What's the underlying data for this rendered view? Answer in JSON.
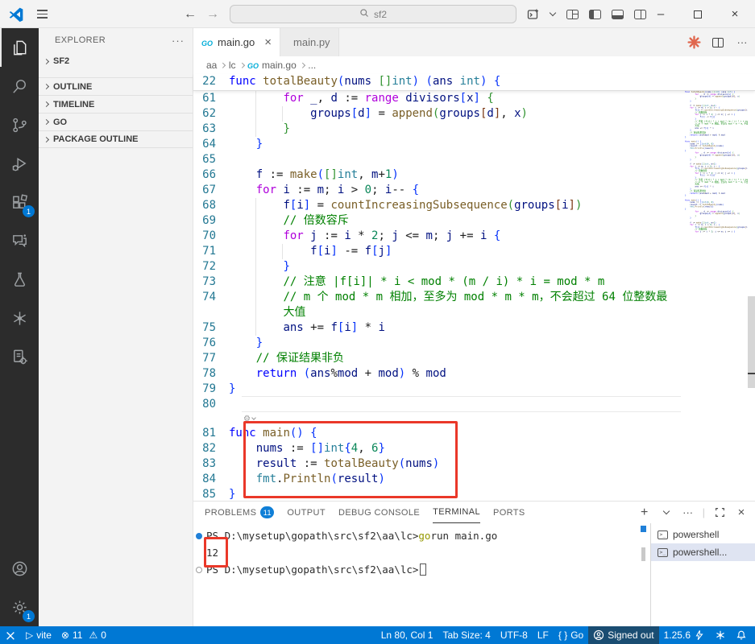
{
  "colors": {
    "accent": "#0078d4",
    "annotation_red": "#ea3829",
    "status_bg": "#0078d4",
    "status_secondary_bg": "#1a4d72",
    "activity_bar_bg": "#2c2c2c",
    "terminal_command_highlight": "#949800",
    "go_brand": "#00add8"
  },
  "title_bar": {
    "search_value": "sf2"
  },
  "activity_bar": {
    "items": [
      {
        "name": "explorer",
        "active": true
      },
      {
        "name": "search"
      },
      {
        "name": "source-control"
      },
      {
        "name": "run-debug"
      },
      {
        "name": "extensions",
        "badge": "1"
      },
      {
        "name": "chat"
      },
      {
        "name": "testing"
      },
      {
        "name": "go-extension"
      },
      {
        "name": "tasks"
      }
    ],
    "bottom": [
      {
        "name": "account"
      },
      {
        "name": "settings",
        "badge": "1"
      }
    ]
  },
  "sidebar": {
    "title": "EXPLORER",
    "sections": [
      {
        "label": "SF2",
        "expanded": true
      },
      {
        "label": "OUTLINE"
      },
      {
        "label": "TIMELINE"
      },
      {
        "label": "GO"
      },
      {
        "label": "PACKAGE OUTLINE"
      }
    ]
  },
  "editor": {
    "tabs": [
      {
        "label": "main.go",
        "icon": "go",
        "active": true,
        "close": "×"
      },
      {
        "label": "main.py",
        "icon": "python",
        "active": false
      }
    ],
    "breadcrumb": [
      {
        "label": "aa"
      },
      {
        "label": "lc"
      },
      {
        "label": "main.go",
        "icon": "go"
      },
      {
        "label": "..."
      }
    ],
    "sticky": {
      "n": "22",
      "ind": 0,
      "tokens": [
        [
          "kw",
          "func "
        ],
        [
          "fn",
          "totalBeauty"
        ],
        [
          "b1",
          "("
        ],
        [
          "v",
          "nums"
        ],
        [
          "pl",
          " "
        ],
        [
          "b2",
          "[]"
        ],
        [
          "ty",
          "int"
        ],
        [
          "b1",
          ")"
        ],
        [
          "pl",
          " "
        ],
        [
          "b1",
          "("
        ],
        [
          "v",
          "ans"
        ],
        [
          "pl",
          " "
        ],
        [
          "ty",
          "int"
        ],
        [
          "b1",
          ")"
        ],
        [
          "pl",
          " "
        ],
        [
          "b1",
          "{"
        ]
      ]
    },
    "lines": [
      {
        "n": "61",
        "ind": 2,
        "tokens": [
          [
            "ctrl",
            "for "
          ],
          [
            "v",
            "_"
          ],
          [
            "pl",
            ", "
          ],
          [
            "v",
            "d"
          ],
          [
            "op",
            " := "
          ],
          [
            "ctrl",
            "range "
          ],
          [
            "v",
            "divisors"
          ],
          [
            "b1",
            "["
          ],
          [
            "v",
            "x"
          ],
          [
            "b1",
            "]"
          ],
          [
            "pl",
            " "
          ],
          [
            "b2",
            "{"
          ]
        ]
      },
      {
        "n": "62",
        "ind": 3,
        "tokens": [
          [
            "v",
            "groups"
          ],
          [
            "b1",
            "["
          ],
          [
            "v",
            "d"
          ],
          [
            "b1",
            "]"
          ],
          [
            "op",
            " = "
          ],
          [
            "fn",
            "append"
          ],
          [
            "b2",
            "("
          ],
          [
            "v",
            "groups"
          ],
          [
            "b3",
            "["
          ],
          [
            "v",
            "d"
          ],
          [
            "b3",
            "]"
          ],
          [
            "pl",
            ", "
          ],
          [
            "v",
            "x"
          ],
          [
            "b2",
            ")"
          ]
        ]
      },
      {
        "n": "63",
        "ind": 2,
        "tokens": [
          [
            "b2",
            "}"
          ]
        ]
      },
      {
        "n": "64",
        "ind": 1,
        "tokens": [
          [
            "b1",
            "}"
          ]
        ]
      },
      {
        "n": "65",
        "ind": 0,
        "tokens": []
      },
      {
        "n": "66",
        "ind": 1,
        "tokens": [
          [
            "v",
            "f"
          ],
          [
            "op",
            " := "
          ],
          [
            "fn",
            "make"
          ],
          [
            "b1",
            "("
          ],
          [
            "b2",
            "[]"
          ],
          [
            "ty",
            "int"
          ],
          [
            "pl",
            ", "
          ],
          [
            "v",
            "m"
          ],
          [
            "op",
            "+"
          ],
          [
            "num",
            "1"
          ],
          [
            "b1",
            ")"
          ]
        ]
      },
      {
        "n": "67",
        "ind": 1,
        "tokens": [
          [
            "ctrl",
            "for "
          ],
          [
            "v",
            "i"
          ],
          [
            "op",
            " := "
          ],
          [
            "v",
            "m"
          ],
          [
            "pl",
            "; "
          ],
          [
            "v",
            "i"
          ],
          [
            "op",
            " > "
          ],
          [
            "num",
            "0"
          ],
          [
            "pl",
            "; "
          ],
          [
            "v",
            "i"
          ],
          [
            "op",
            "--"
          ],
          [
            "pl",
            " "
          ],
          [
            "b1",
            "{"
          ]
        ]
      },
      {
        "n": "68",
        "ind": 2,
        "tokens": [
          [
            "v",
            "f"
          ],
          [
            "b1",
            "["
          ],
          [
            "v",
            "i"
          ],
          [
            "b1",
            "]"
          ],
          [
            "op",
            " = "
          ],
          [
            "fn",
            "countIncreasingSubsequence"
          ],
          [
            "b2",
            "("
          ],
          [
            "v",
            "groups"
          ],
          [
            "b3",
            "["
          ],
          [
            "v",
            "i"
          ],
          [
            "b3",
            "]"
          ],
          [
            "b2",
            ")"
          ]
        ]
      },
      {
        "n": "69",
        "ind": 2,
        "tokens": [
          [
            "cm",
            "// 倍数容斥"
          ]
        ]
      },
      {
        "n": "70",
        "ind": 2,
        "tokens": [
          [
            "ctrl",
            "for "
          ],
          [
            "v",
            "j"
          ],
          [
            "op",
            " := "
          ],
          [
            "v",
            "i"
          ],
          [
            "op",
            " * "
          ],
          [
            "num",
            "2"
          ],
          [
            "pl",
            "; "
          ],
          [
            "v",
            "j"
          ],
          [
            "op",
            " <= "
          ],
          [
            "v",
            "m"
          ],
          [
            "pl",
            "; "
          ],
          [
            "v",
            "j"
          ],
          [
            "op",
            " += "
          ],
          [
            "v",
            "i"
          ],
          [
            "pl",
            " "
          ],
          [
            "b1",
            "{"
          ]
        ]
      },
      {
        "n": "71",
        "ind": 3,
        "tokens": [
          [
            "v",
            "f"
          ],
          [
            "b1",
            "["
          ],
          [
            "v",
            "i"
          ],
          [
            "b1",
            "]"
          ],
          [
            "op",
            " -= "
          ],
          [
            "v",
            "f"
          ],
          [
            "b1",
            "["
          ],
          [
            "v",
            "j"
          ],
          [
            "b1",
            "]"
          ]
        ]
      },
      {
        "n": "72",
        "ind": 2,
        "tokens": [
          [
            "b1",
            "}"
          ]
        ]
      },
      {
        "n": "73",
        "ind": 2,
        "tokens": [
          [
            "cm",
            "// 注意 |f[i]| * i < mod * (m / i) * i = mod * m"
          ]
        ]
      },
      {
        "n": "74",
        "ind": 2,
        "tokens": [
          [
            "cm",
            "// m 个 mod * m 相加，至多为 mod * m * m，不会超过 64 位整数最"
          ]
        ]
      },
      {
        "n": "",
        "ind": 2,
        "tokens": [
          [
            "cm",
            "大值"
          ]
        ]
      },
      {
        "n": "75",
        "ind": 2,
        "tokens": [
          [
            "v",
            "ans"
          ],
          [
            "op",
            " += "
          ],
          [
            "v",
            "f"
          ],
          [
            "b1",
            "["
          ],
          [
            "v",
            "i"
          ],
          [
            "b1",
            "]"
          ],
          [
            "op",
            " * "
          ],
          [
            "v",
            "i"
          ]
        ]
      },
      {
        "n": "76",
        "ind": 1,
        "tokens": [
          [
            "b1",
            "}"
          ]
        ]
      },
      {
        "n": "77",
        "ind": 1,
        "tokens": [
          [
            "cm",
            "// 保证结果非负"
          ]
        ]
      },
      {
        "n": "78",
        "ind": 1,
        "tokens": [
          [
            "kw",
            "return "
          ],
          [
            "b1",
            "("
          ],
          [
            "v",
            "ans"
          ],
          [
            "op",
            "%"
          ],
          [
            "v",
            "mod"
          ],
          [
            "op",
            " + "
          ],
          [
            "v",
            "mod"
          ],
          [
            "b1",
            ")"
          ],
          [
            "op",
            " % "
          ],
          [
            "v",
            "mod"
          ]
        ]
      },
      {
        "n": "79",
        "ind": 0,
        "tokens": [
          [
            "b1",
            "}"
          ]
        ],
        "sep": true
      },
      {
        "n": "80",
        "ind": 0,
        "tokens": [],
        "sep": true
      },
      {
        "widget": "code-action"
      },
      {
        "n": "81",
        "ind": 0,
        "tokens": [
          [
            "kw",
            "func "
          ],
          [
            "fn",
            "main"
          ],
          [
            "b1",
            "()"
          ],
          [
            "pl",
            " "
          ],
          [
            "b1",
            "{"
          ]
        ]
      },
      {
        "n": "82",
        "ind": 1,
        "tokens": [
          [
            "v",
            "nums"
          ],
          [
            "op",
            " := "
          ],
          [
            "b1",
            "[]"
          ],
          [
            "ty",
            "int"
          ],
          [
            "b1",
            "{"
          ],
          [
            "num",
            "4"
          ],
          [
            "pl",
            ", "
          ],
          [
            "num",
            "6"
          ],
          [
            "b1",
            "}"
          ]
        ]
      },
      {
        "n": "83",
        "ind": 1,
        "tokens": [
          [
            "v",
            "result"
          ],
          [
            "op",
            " := "
          ],
          [
            "fn",
            "totalBeauty"
          ],
          [
            "b1",
            "("
          ],
          [
            "v",
            "nums"
          ],
          [
            "b1",
            ")"
          ]
        ]
      },
      {
        "n": "84",
        "ind": 1,
        "tokens": [
          [
            "ty",
            "fmt"
          ],
          [
            "pl",
            "."
          ],
          [
            "fn",
            "Println"
          ],
          [
            "b1",
            "("
          ],
          [
            "v",
            "result"
          ],
          [
            "b1",
            ")"
          ]
        ]
      },
      {
        "n": "85",
        "ind": 0,
        "tokens": [
          [
            "b1",
            "}"
          ]
        ]
      }
    ]
  },
  "panel": {
    "tabs": [
      {
        "label": "PROBLEMS",
        "badge": "11"
      },
      {
        "label": "OUTPUT"
      },
      {
        "label": "DEBUG CONSOLE"
      },
      {
        "label": "TERMINAL",
        "active": true
      },
      {
        "label": "PORTS"
      }
    ]
  },
  "terminal": {
    "lines": [
      {
        "decoration": "filled",
        "prompt": "PS D:\\mysetup\\gopath\\src\\sf2\\aa\\lc>",
        "command": [
          [
            "hl",
            "go"
          ],
          [
            "plain",
            " run main.go"
          ]
        ]
      },
      {
        "output": "12",
        "boxed": true
      },
      {
        "decoration": "hollow",
        "prompt": "PS D:\\mysetup\\gopath\\src\\sf2\\aa\\lc>",
        "cursor": true
      }
    ],
    "tabs": [
      {
        "label": "powershell",
        "selected": false
      },
      {
        "label": "powershell...",
        "selected": true
      }
    ]
  },
  "status_bar": {
    "run_label": "vite",
    "errors": "11",
    "warnings": "0",
    "cursor": "Ln 80, Col 1",
    "tab_size": "Tab Size: 4",
    "encoding": "UTF-8",
    "eol": "LF",
    "lang_braces": "{ }",
    "language": "Go",
    "account": "Signed out",
    "go_version": "1.25.6"
  }
}
